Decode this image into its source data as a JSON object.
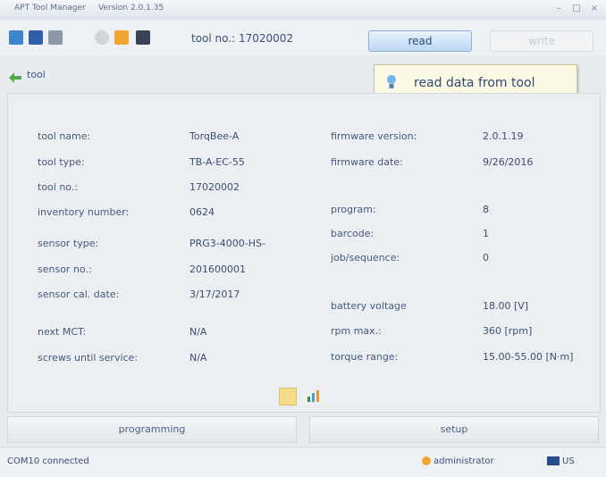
{
  "title": {
    "app": "APT Tool Manager",
    "version": "Version 2.0.1.35"
  },
  "window_controls": {
    "minimize": "–",
    "maximize": "□",
    "close": "×"
  },
  "toolbar": {
    "toolno_label": "tool no.: 17020002",
    "read_label": "read",
    "write_label": "write"
  },
  "tooltip": {
    "text": "read data from tool"
  },
  "nav": {
    "back_label": "tool"
  },
  "info": {
    "left": [
      {
        "label": "tool name:",
        "value": "TorqBee-A"
      },
      {
        "label": "tool type:",
        "value": "TB-A-EC-55"
      },
      {
        "label": "tool no.:",
        "value": "17020002"
      },
      {
        "label": "inventory number:",
        "value": "0624"
      },
      {
        "label": "sensor type:",
        "value": "PRG3-4000-HS-"
      },
      {
        "label": "sensor no.:",
        "value": "201600001"
      },
      {
        "label": "sensor cal. date:",
        "value": "3/17/2017"
      },
      {
        "label": "next MCT:",
        "value": "N/A"
      },
      {
        "label": "screws until service:",
        "value": "N/A"
      }
    ],
    "right": [
      {
        "label": "firmware version:",
        "value": "2.0.1.19"
      },
      {
        "label": "firmware date:",
        "value": "9/26/2016"
      },
      {
        "label": "program:",
        "value": "8"
      },
      {
        "label": "barcode:",
        "value": "1"
      },
      {
        "label": "job/sequence:",
        "value": "0"
      },
      {
        "label": "battery voltage",
        "value": "18.00 [V]"
      },
      {
        "label": "rpm max.:",
        "value": "360 [rpm]"
      },
      {
        "label": "torque range:",
        "value": "15.00-55.00 [N·m]"
      }
    ]
  },
  "buttons": {
    "programming": "programming",
    "setup": "setup"
  },
  "status": {
    "connection": "COM10 connected",
    "user": "administrator",
    "lang": "US"
  },
  "colors": {
    "accent": "#5b8fd0",
    "panel": "#eceff2",
    "text": "#3b4f74"
  },
  "icons": [
    "folder-icon",
    "save-icon",
    "settings-icon",
    "disabled-icon",
    "user-icon",
    "lock-icon",
    "back-arrow-icon",
    "bulb-icon",
    "document-icon",
    "chart-icon",
    "flag-icon"
  ]
}
